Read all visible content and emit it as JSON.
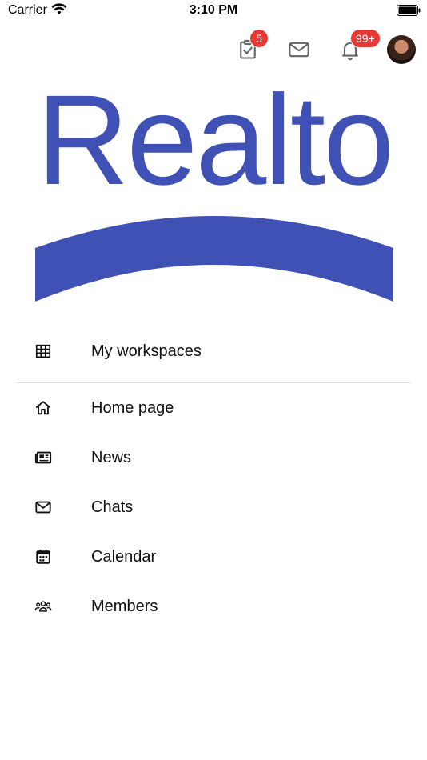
{
  "status_bar": {
    "carrier": "Carrier",
    "time": "3:10 PM",
    "icons": [
      "wifi-icon",
      "battery-icon"
    ]
  },
  "top_bar": {
    "tasks_badge": "5",
    "notifications_badge": "99+",
    "icons": [
      "clipboard-check-icon",
      "mail-icon",
      "bell-icon",
      "avatar"
    ],
    "badge_color": "#e53935"
  },
  "logo": {
    "text": "Realto",
    "color": "#3f51b5"
  },
  "menu": {
    "workspaces": {
      "label": "My workspaces",
      "icon": "grid-icon"
    },
    "items": [
      {
        "label": "Home page",
        "icon": "home-icon"
      },
      {
        "label": "News",
        "icon": "newspaper-icon"
      },
      {
        "label": "Chats",
        "icon": "mail-icon"
      },
      {
        "label": "Calendar",
        "icon": "calendar-icon"
      },
      {
        "label": "Members",
        "icon": "users-icon"
      }
    ]
  }
}
